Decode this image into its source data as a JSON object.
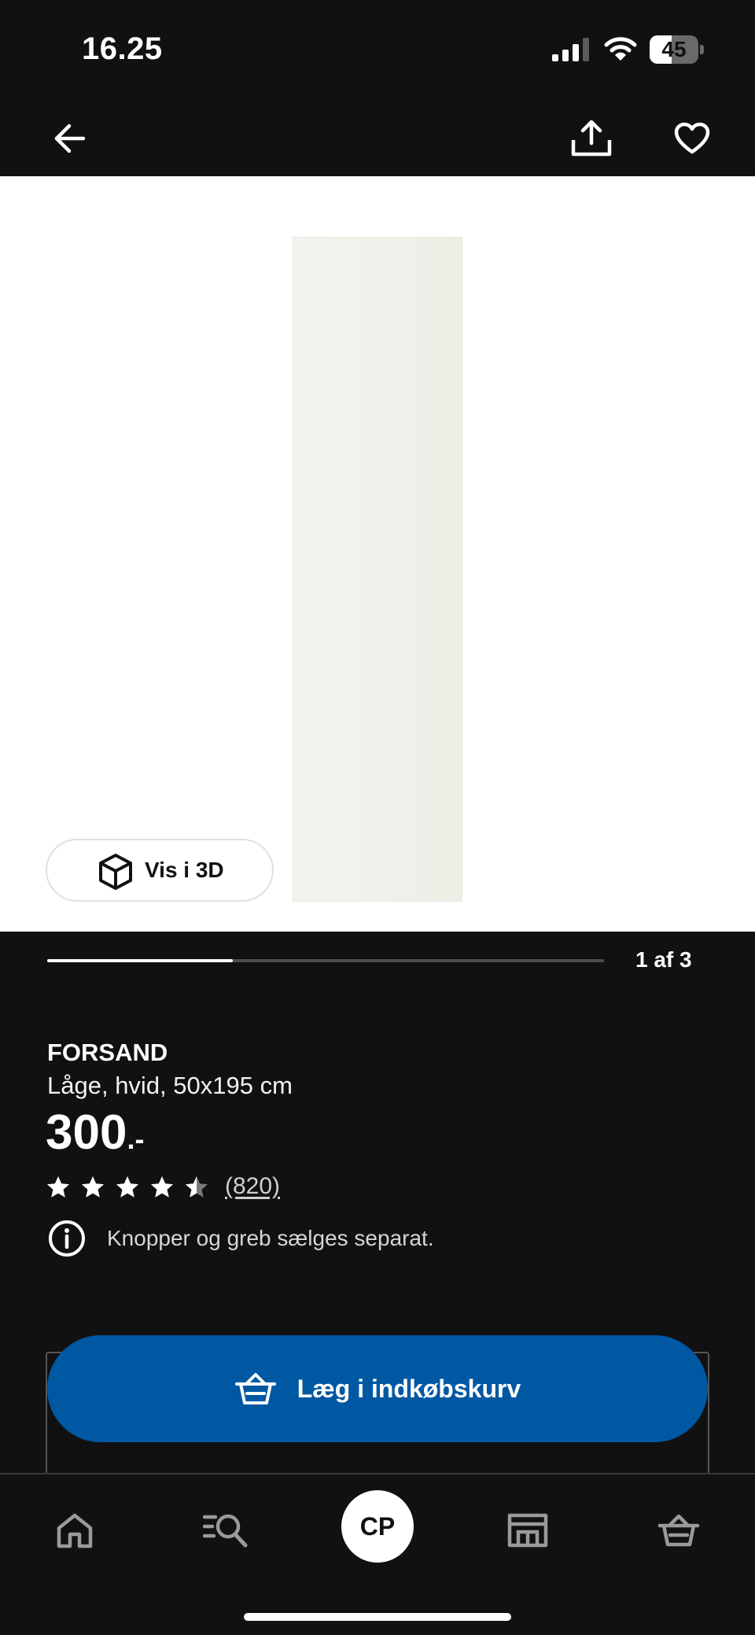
{
  "status_bar": {
    "time": "16.25",
    "battery_level": "45",
    "battery_fraction": 0.45,
    "icons": [
      "cellular-signal-icon",
      "wifi-icon",
      "battery-icon"
    ]
  },
  "top_nav": {
    "icons": [
      "arrow-left-icon",
      "share-icon",
      "heart-icon"
    ]
  },
  "gallery": {
    "view_3d_label": "Vis i 3D",
    "view_3d_icon": "cube-icon",
    "current_image": 1,
    "total_images": 3,
    "page_indicator": "1 af 3"
  },
  "product": {
    "name": "FORSAND",
    "description": "Låge, hvid, 50x195 cm",
    "price": "300",
    "price_suffix": ".-",
    "rating": 4.5,
    "max_rating": 5,
    "review_count": "(820)",
    "notice_icon": "info-icon",
    "notice": "Knopper og greb sælges separat."
  },
  "actions": {
    "add_to_cart_label": "Læg i indkøbskurv",
    "add_to_cart_icon": "basket-icon"
  },
  "bottom_nav": {
    "tabs": [
      {
        "name": "home",
        "icon": "home-icon"
      },
      {
        "name": "search",
        "icon": "search-list-icon"
      },
      {
        "name": "profile",
        "initials": "CP"
      },
      {
        "name": "store",
        "icon": "store-icon"
      },
      {
        "name": "cart",
        "icon": "basket-icon"
      }
    ]
  },
  "colors": {
    "background": "#111111",
    "primary_button": "#0058a3",
    "gallery_background": "#ffffff"
  }
}
